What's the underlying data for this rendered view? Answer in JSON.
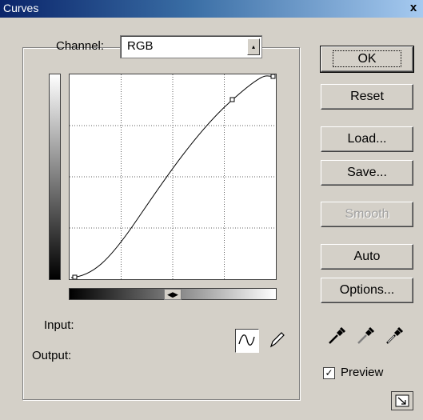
{
  "window": {
    "title": "Curves",
    "close_label": "x"
  },
  "channel": {
    "label": "Channel:",
    "value": "RGB"
  },
  "readouts": {
    "input_label": "Input:",
    "output_label": "Output:"
  },
  "buttons": {
    "ok": "OK",
    "reset": "Reset",
    "load": "Load...",
    "save": "Save...",
    "smooth": "Smooth",
    "auto": "Auto",
    "options": "Options..."
  },
  "preview": {
    "label": "Preview",
    "checked": true
  },
  "icons": [
    "curve-tool-icon",
    "pencil-tool-icon",
    "black-eyedropper-icon",
    "gray-eyedropper-icon",
    "white-eyedropper-icon",
    "expand-icon"
  ],
  "colors": {
    "title_start": "#0a246a",
    "title_end": "#a6caf0",
    "face": "#d4d0c8"
  }
}
